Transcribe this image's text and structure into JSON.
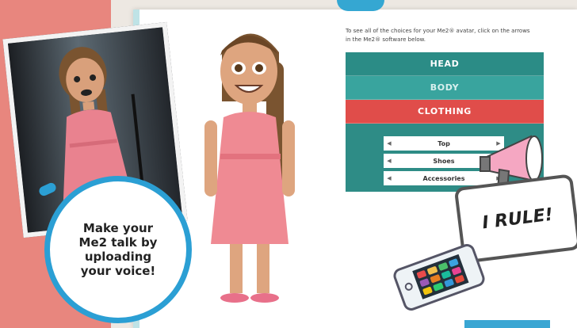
{
  "intro": {
    "text": "To see all of the choices for your Me2® avatar, click on the arrows in the Me2® software below."
  },
  "menu": {
    "tabs": [
      {
        "label": "HEAD"
      },
      {
        "label": "BODY"
      },
      {
        "label": "CLOTHING"
      }
    ],
    "rows": [
      {
        "label": "Top"
      },
      {
        "label": "Shoes"
      },
      {
        "label": "Accessories"
      }
    ]
  },
  "callout": {
    "text": "Make your Me2 talk by uploading your voice!"
  },
  "sign": {
    "text": "I RULE!"
  },
  "colors": {
    "teal": "#2e8c86",
    "red": "#e04d4a",
    "blue": "#2b9fd4",
    "salmon": "#e8867e"
  },
  "icons": [
    "megaphone-icon",
    "smartphone-icon",
    "arrow-left-icon",
    "arrow-right-icon"
  ]
}
